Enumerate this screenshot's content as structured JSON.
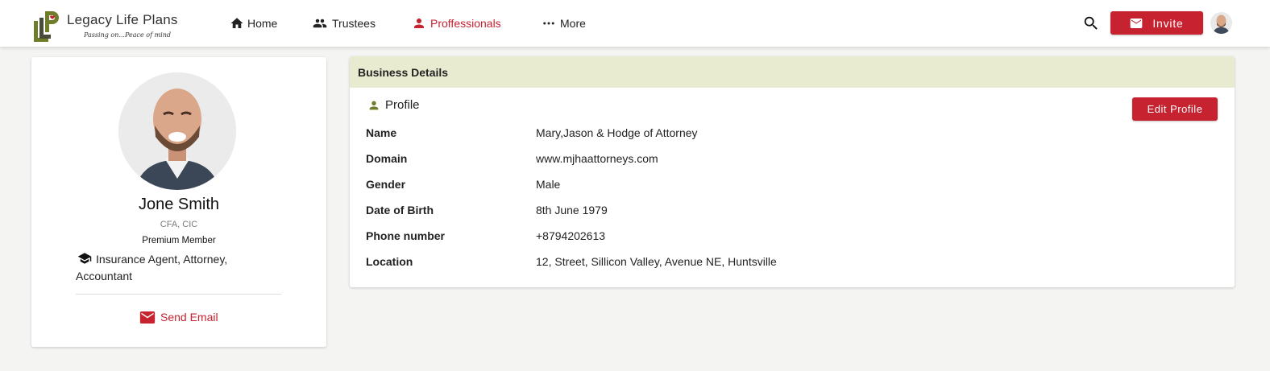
{
  "app": {
    "logo_title": "Legacy Life Plans",
    "logo_tagline": "Passing on...Peace of mind",
    "brand_color": "#c62230",
    "logo_green": "#6f7d2b"
  },
  "nav": {
    "items": [
      {
        "label": "Home",
        "icon": "home-icon"
      },
      {
        "label": "Trustees",
        "icon": "people-icon"
      },
      {
        "label": "Proffessionals",
        "icon": "person-icon",
        "active": true
      },
      {
        "label": "More",
        "icon": "more-horizontal-icon"
      }
    ],
    "invite_label": "Invite"
  },
  "profile": {
    "name": "Jone Smith",
    "credentials": "CFA, CIC",
    "membership": "Premium Member",
    "roles": "Insurance Agent, Attorney, Accountant",
    "send_email_label": "Send Email"
  },
  "details": {
    "header": "Business Details",
    "section_label": "Profile",
    "edit_label": "Edit Profile",
    "fields": [
      {
        "label": "Name",
        "value": "Mary,Jason & Hodge of Attorney"
      },
      {
        "label": "Domain",
        "value": "www.mjhaattorneys.com"
      },
      {
        "label": "Gender",
        "value": "Male"
      },
      {
        "label": "Date of Birth",
        "value": "8th June 1979"
      },
      {
        "label": "Phone number",
        "value": "+8794202613"
      },
      {
        "label": "Location",
        "value": "12, Street, Sillicon Valley, Avenue NE, Huntsville"
      }
    ]
  }
}
